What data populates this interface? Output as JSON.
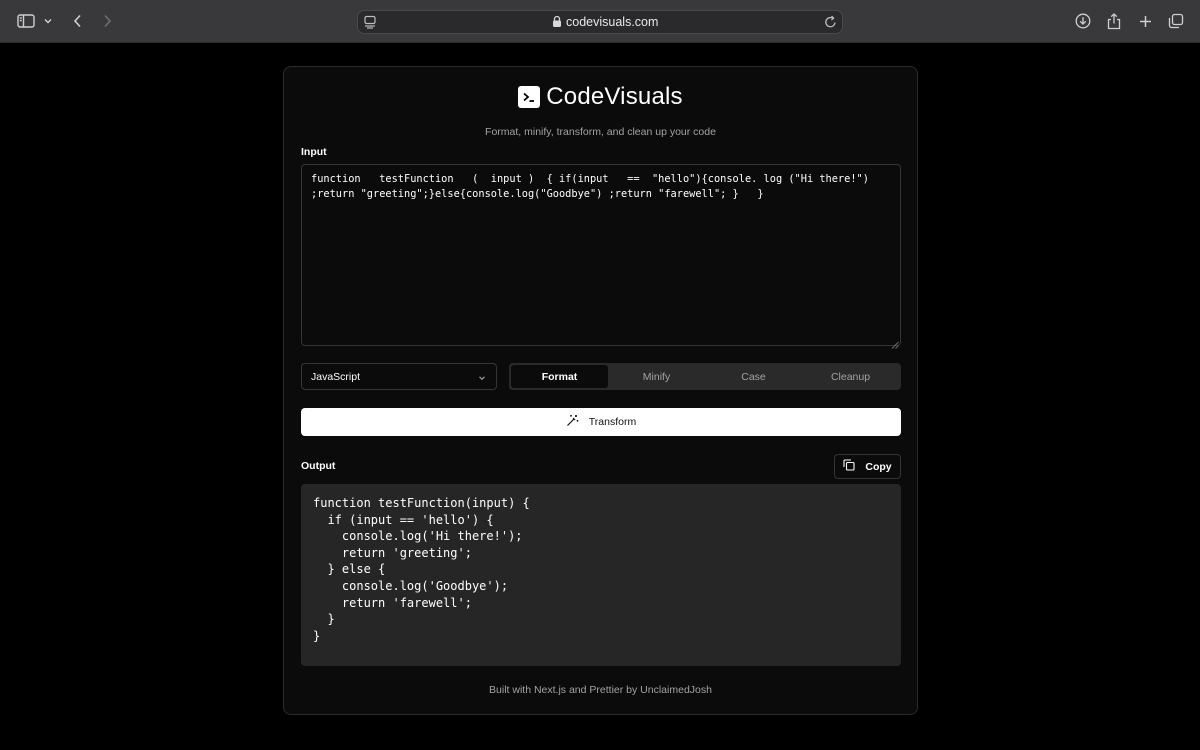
{
  "browser": {
    "url": "codevisuals.com"
  },
  "app": {
    "name": "CodeVisuals",
    "tagline": "Format, minify, transform, and clean up your code",
    "footer": "Built with Next.js and Prettier by UnclaimedJosh"
  },
  "input": {
    "label": "Input",
    "value": "function   testFunction   (  input )  { if(input   ==  \"hello\"){console. log (\"Hi there!\")\n;return \"greeting\";}else{console.log(\"Goodbye\") ;return \"farewell\"; }   }"
  },
  "controls": {
    "language": "JavaScript",
    "modes": [
      "Format",
      "Minify",
      "Case",
      "Cleanup"
    ],
    "active_mode": "Format",
    "transform_label": "Transform"
  },
  "output": {
    "label": "Output",
    "copy_label": "Copy",
    "value": "function testFunction(input) {\n  if (input == 'hello') {\n    console.log('Hi there!');\n    return 'greeting';\n  } else {\n    console.log('Goodbye');\n    return 'farewell';\n  }\n}"
  },
  "icons": {
    "sidebar": "sidebar-icon",
    "back": "chevron-left-icon",
    "forward": "chevron-right-icon",
    "download": "download-icon",
    "share": "share-icon",
    "new_tab": "plus-icon",
    "tabs": "tabs-overview-icon",
    "transform": "magic-wand-icon",
    "copy": "copy-icon"
  }
}
